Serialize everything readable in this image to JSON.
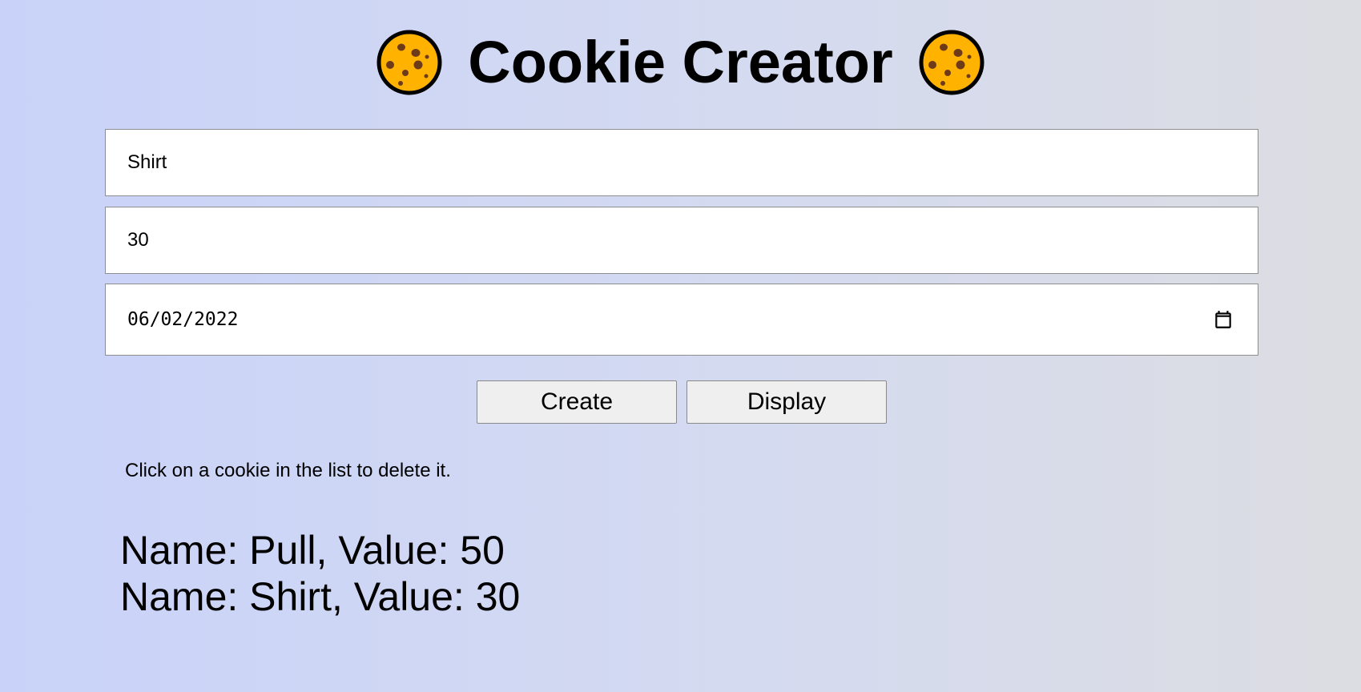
{
  "header": {
    "title": "Cookie Creator",
    "icon_left": "cookie-icon",
    "icon_right": "cookie-icon"
  },
  "form": {
    "name_value": "Shirt",
    "value_value": "30",
    "date_value": "06/02/2022",
    "date_icon": "calendar-icon"
  },
  "buttons": {
    "create_label": "Create",
    "display_label": "Display"
  },
  "hint": "Click on a cookie in the list to delete it.",
  "cookies": [
    "Name: Pull, Value: 50",
    "Name: Shirt, Value: 30"
  ],
  "colors": {
    "cookie_fill": "#ffb300",
    "cookie_chips": "#6d3a1a",
    "background_left": "#c9d3f9",
    "background_right": "#dcdde2",
    "button_bg": "#efefef"
  }
}
